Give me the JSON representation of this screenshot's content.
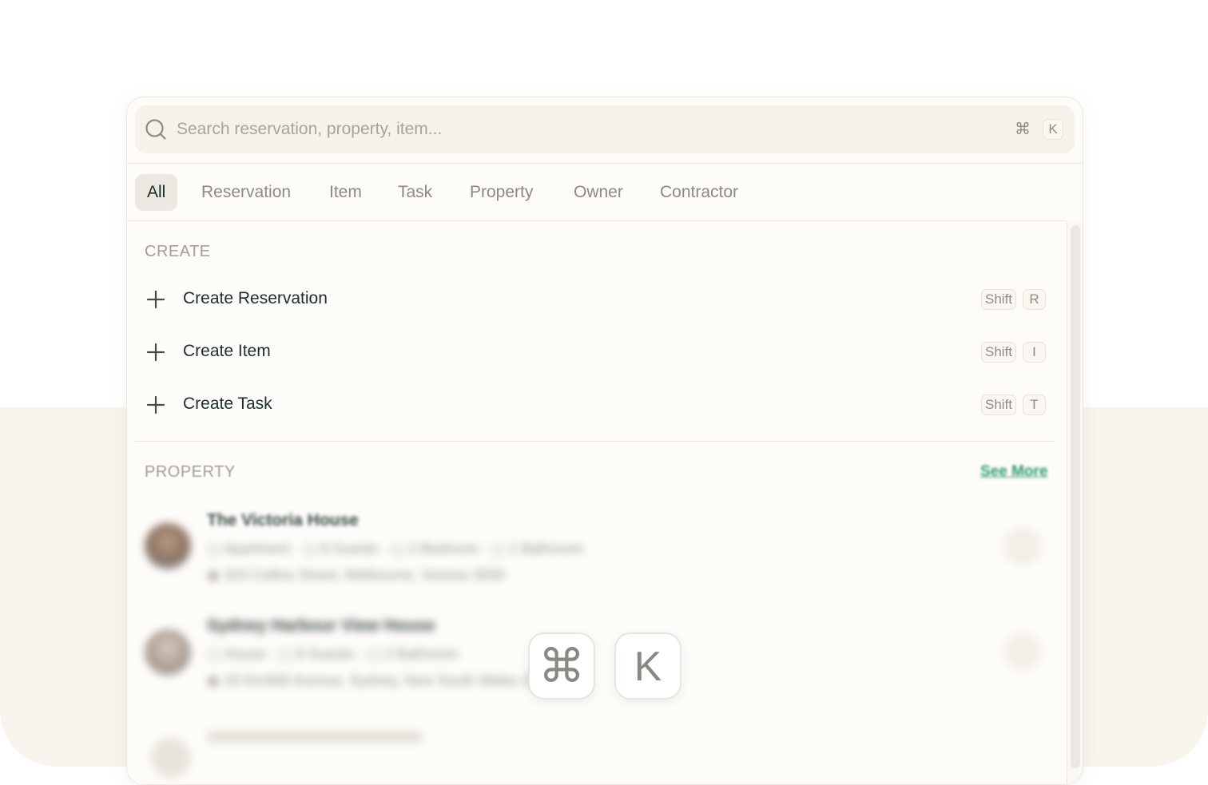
{
  "search": {
    "placeholder": "Search reservation, property, item...",
    "shortcut_cmd": "⌘",
    "shortcut_key": "K"
  },
  "tabs": [
    {
      "label": "All",
      "active": true
    },
    {
      "label": "Reservation"
    },
    {
      "label": "Item"
    },
    {
      "label": "Task"
    },
    {
      "label": "Property"
    },
    {
      "label": "Owner"
    },
    {
      "label": "Contractor"
    }
  ],
  "create": {
    "heading": "CREATE",
    "items": [
      {
        "label": "Create Reservation",
        "mod": "Shift",
        "key": "R"
      },
      {
        "label": "Create Item",
        "mod": "Shift",
        "key": "I"
      },
      {
        "label": "Create Task",
        "mod": "Shift",
        "key": "T"
      }
    ]
  },
  "property": {
    "heading": "PROPERTY",
    "see_more": "See More",
    "items": [
      {
        "name": "The Victoria House",
        "type": "Apartment",
        "guests": "8 Guests",
        "bedrooms": "2 Bedroom",
        "bathrooms": "1 Bathroom",
        "address": "323 Collins Street, Melbourne, Victoria 3000"
      },
      {
        "name": "Sydney Harbour View House",
        "type": "House",
        "guests": "6 Guests",
        "bedrooms": "3 Bedroom",
        "bathrooms": "2 Bathroom",
        "address": "18 Kirribilli Avenue, Sydney, New South Wales 2061"
      }
    ]
  },
  "hint": {
    "cmd": "⌘",
    "key": "K"
  },
  "colors": {
    "accent": "#2e9b6f",
    "band": "#f8f4ee",
    "text": "#1b3029"
  }
}
